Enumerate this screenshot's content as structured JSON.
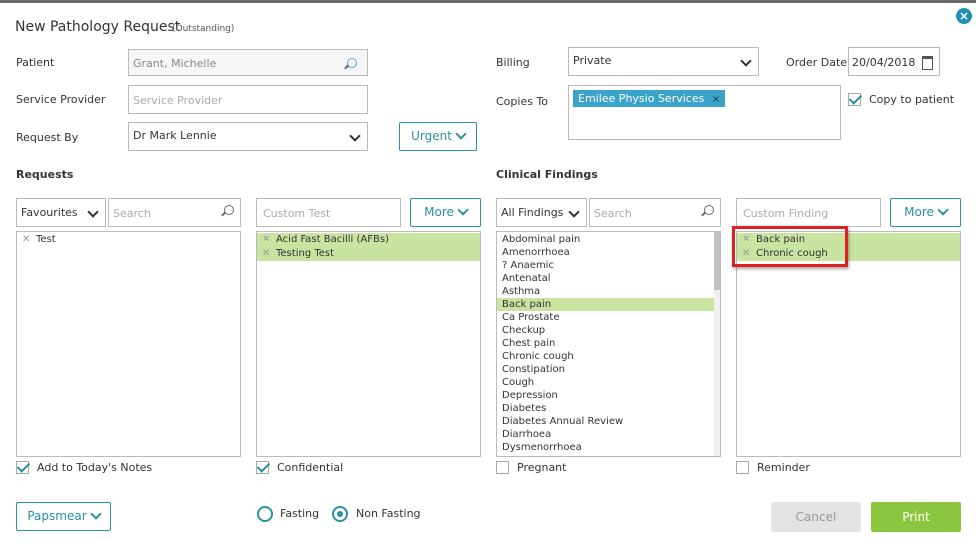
{
  "dialog": {
    "title": "New Pathology Request",
    "status": "(Outstanding)"
  },
  "patient": {
    "label": "Patient",
    "value": "Grant, Michelle"
  },
  "service_provider": {
    "label": "Service Provider",
    "placeholder": "Service Provider"
  },
  "request_by": {
    "label": "Request By",
    "value": "Dr Mark Lennie",
    "urgent_label": "Urgent"
  },
  "billing": {
    "label": "Billing",
    "value": "Private"
  },
  "order_date": {
    "label": "Order Date",
    "value": "20/04/2018"
  },
  "copies_to": {
    "label": "Copies To",
    "chips": [
      "Emilee Physio Services"
    ],
    "copy_to_patient_label": "Copy to patient",
    "copy_to_patient": true
  },
  "requests": {
    "heading": "Requests",
    "list_select": "Favourites",
    "search_placeholder": "Search",
    "custom_placeholder": "Custom Test",
    "more_label": "More",
    "favourites": [
      "Test"
    ],
    "selected_tests": [
      "Acid Fast Bacilli (AFBs)",
      "Testing Test"
    ],
    "add_notes_label": "Add to Today's Notes",
    "add_notes": true,
    "confidential_label": "Confidential",
    "confidential": true
  },
  "clinical": {
    "heading": "Clinical Findings",
    "list_select": "All Findings",
    "search_placeholder": "Search",
    "custom_placeholder": "Custom Finding",
    "more_label": "More",
    "findings": [
      "Abdominal pain",
      "Amenorrhoea",
      "? Anaemic",
      "Antenatal",
      "Asthma",
      "Back pain",
      "Ca Prostate",
      "Checkup",
      "Chest pain",
      "Chronic cough",
      "Constipation",
      "Cough",
      "Depression",
      "Diabetes",
      "Diabetes Annual Review",
      "Diarrhoea",
      "Dysmenorrhoea"
    ],
    "highlighted_finding": "Back pain",
    "selected_findings": [
      "Back pain",
      "Chronic cough"
    ],
    "pregnant_label": "Pregnant",
    "pregnant": false,
    "reminder_label": "Reminder",
    "reminder": false
  },
  "footer": {
    "papsmear_label": "Papsmear",
    "fasting_label": "Fasting",
    "non_fasting_label": "Non Fasting",
    "fasting_choice": "Non Fasting",
    "cancel_label": "Cancel",
    "print_label": "Print"
  },
  "colors": {
    "accent": "#2a8fa8",
    "selected_row": "#c9e3a1",
    "print": "#8cc63f",
    "highlight_box": "#e0201f"
  }
}
